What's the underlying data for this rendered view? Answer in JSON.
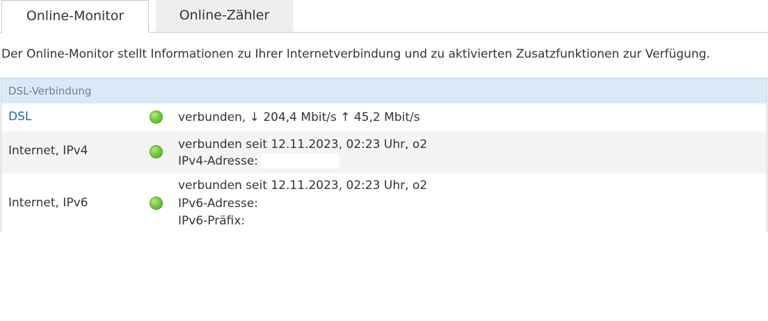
{
  "tabs": [
    {
      "label": "Online-Monitor",
      "active": true
    },
    {
      "label": "Online-Zähler",
      "active": false
    }
  ],
  "intro_text": "Der Online-Monitor stellt Informationen zu Ihrer Internetverbindung und zu aktivierten Zusatzfunktionen zur Verfügung.",
  "section": {
    "title": "DSL-Verbindung",
    "rows": [
      {
        "label": "DSL",
        "status_icon": "green-led-icon",
        "lines": [
          "verbunden, ↓ 204,4 Mbit/s ↑ 45,2 Mbit/s"
        ]
      },
      {
        "label": "Internet, IPv4",
        "status_icon": "green-led-icon",
        "lines": [
          "verbunden seit 12.11.2023, 02:23 Uhr, o2",
          "IPv4-Adresse:"
        ]
      },
      {
        "label": "Internet, IPv6",
        "status_icon": "green-led-icon",
        "lines": [
          "verbunden seit 12.11.2023, 02:23 Uhr, o2",
          "IPv6-Adresse:",
          "IPv6-Präfix:"
        ]
      }
    ]
  },
  "colors": {
    "header_bg": "#d9e9f7",
    "link": "#1b67a8",
    "status_green": "#72c93b",
    "alt_row_bg": "#f4f4f2"
  }
}
